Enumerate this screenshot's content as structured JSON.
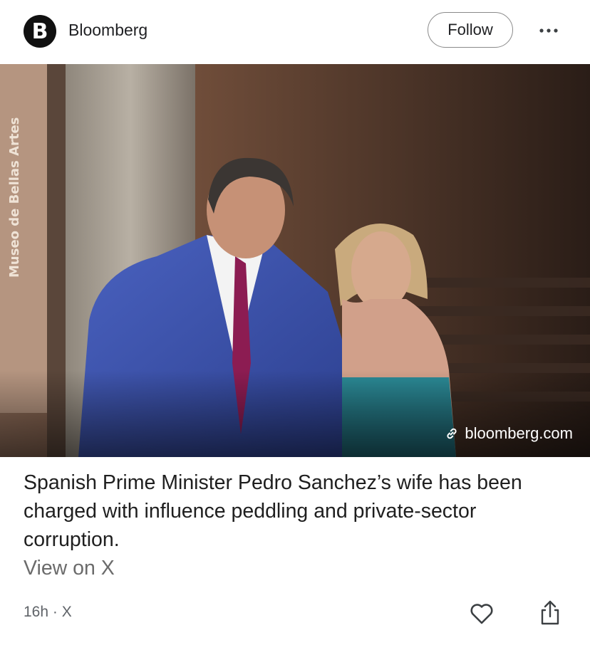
{
  "header": {
    "logo_letter": "B",
    "source_name": "Bloomberg",
    "follow_label": "Follow",
    "more_icon": "more-horizontal-icon"
  },
  "hero": {
    "wall_sign": "Museo de Bellas Artes",
    "link_text": "bloomberg.com",
    "link_icon": "link-icon"
  },
  "post": {
    "headline": "Spanish Prime Minister Pedro Sanchez’s wife has been charged with influence peddling and private-sector corruption.",
    "view_on": "View on X"
  },
  "footer": {
    "meta": "16h · X",
    "like_icon": "heart-icon",
    "share_icon": "share-icon"
  }
}
